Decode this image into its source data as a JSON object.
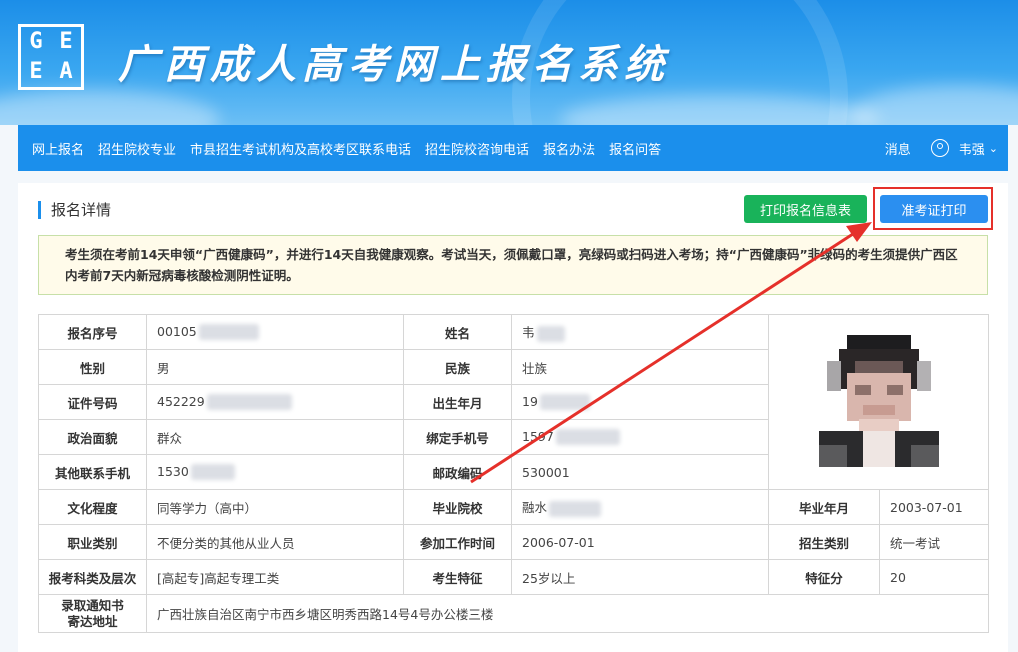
{
  "header": {
    "logo_letters": [
      "G",
      "E",
      "E",
      "A"
    ],
    "title": "广西成人高考网上报名系统"
  },
  "nav": {
    "items": [
      "网上报名",
      "招生院校专业",
      "市县招生考试机构及高校考区联系电话",
      "招生院校咨询电话",
      "报名办法",
      "报名问答"
    ],
    "messages": "消息",
    "user_name": "韦强",
    "chevron": "⌄"
  },
  "section": {
    "title": "报名详情",
    "print_info_label": "打印报名信息表",
    "print_ticket_label": "准考证打印"
  },
  "notice": {
    "text": "考生须在考前14天申领“广西健康码”，并进行14天自我健康观察。考试当天，须佩戴口罩，亮绿码或扫码进入考场；持“广西健康码”非绿码的考生须提供广西区内考前7天内新冠病毒核酸检测阴性证明。"
  },
  "table": {
    "labels": {
      "reg_no": "报名序号",
      "name": "姓名",
      "gender": "性别",
      "ethnicity": "民族",
      "id_no": "证件号码",
      "birth": "出生年月",
      "politics": "政治面貌",
      "phone": "绑定手机号",
      "other_phone": "其他联系手机",
      "postcode": "邮政编码",
      "education": "文化程度",
      "school": "毕业院校",
      "grad_date": "毕业年月",
      "job": "职业类别",
      "work_start": "参加工作时间",
      "admission_type": "招生类别",
      "subject": "报考科类及层次",
      "feature": "考生特征",
      "feature_score": "特征分",
      "address_l1": "录取通知书",
      "address_l2": "寄达地址"
    },
    "values": {
      "reg_no": "00105",
      "name": "韦",
      "gender": "男",
      "ethnicity": "壮族",
      "id_no": "452229",
      "birth": "19",
      "politics": "群众",
      "phone": "1597",
      "other_phone": "1530",
      "postcode": "530001",
      "education": "同等学力（高中）",
      "school": "融水",
      "grad_date": "2003-07-01",
      "job": "不便分类的其他从业人员",
      "work_start": "2006-07-01",
      "admission_type": "统一考试",
      "subject": "[高起专]高起专理工类",
      "feature": "25岁以上",
      "feature_score": "20",
      "address": "广西壮族自治区南宁市西乡塘区明秀西路14号4号办公楼三楼"
    }
  },
  "colors": {
    "nav_blue": "#1b8fec",
    "green": "#19b35a",
    "blue_button": "#2b8ff0",
    "annotation_red": "#e5302a"
  }
}
